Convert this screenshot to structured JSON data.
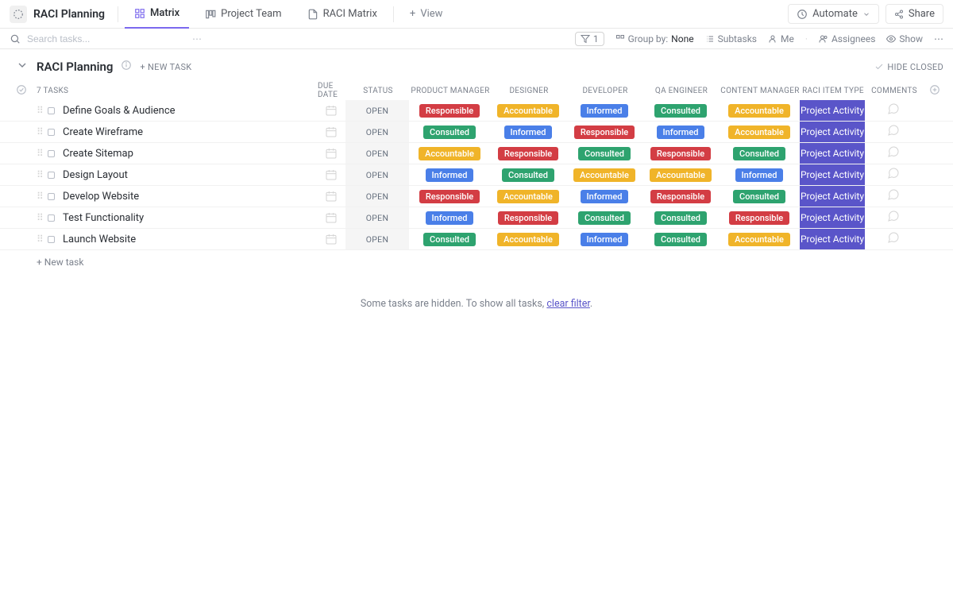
{
  "header": {
    "title": "RACI Planning",
    "tabs": [
      {
        "label": "Matrix",
        "active": true
      },
      {
        "label": "Project Team",
        "active": false
      },
      {
        "label": "RACI Matrix",
        "active": false
      }
    ],
    "view_btn": "View",
    "automate": "Automate",
    "share": "Share"
  },
  "toolbar": {
    "search_placeholder": "Search tasks...",
    "filter_count": "1",
    "group_by_label": "Group by:",
    "group_by_value": "None",
    "subtasks": "Subtasks",
    "me": "Me",
    "assignees": "Assignees",
    "show": "Show"
  },
  "list": {
    "name": "RACI Planning",
    "new_task": "+ NEW TASK",
    "hide_closed": "HIDE CLOSED",
    "task_count": "7 TASKS",
    "columns": {
      "due": "DUE DATE",
      "status": "STATUS",
      "pm": "PRODUCT MANAGER",
      "designer": "DESIGNER",
      "developer": "DEVELOPER",
      "qa": "QA ENGINEER",
      "cm": "CONTENT MANAGER",
      "type": "RACI ITEM TYPE",
      "comments": "COMMENTS"
    }
  },
  "tasks": [
    {
      "name": "Define Goals & Audience",
      "status": "OPEN",
      "pm": "Responsible",
      "designer": "Accountable",
      "developer": "Informed",
      "qa": "Consulted",
      "cm": "Accountable",
      "type": "Project Activity"
    },
    {
      "name": "Create Wireframe",
      "status": "OPEN",
      "pm": "Consulted",
      "designer": "Informed",
      "developer": "Responsible",
      "qa": "Informed",
      "cm": "Accountable",
      "type": "Project Activity"
    },
    {
      "name": "Create Sitemap",
      "status": "OPEN",
      "pm": "Accountable",
      "designer": "Responsible",
      "developer": "Consulted",
      "qa": "Responsible",
      "cm": "Consulted",
      "type": "Project Activity"
    },
    {
      "name": "Design Layout",
      "status": "OPEN",
      "pm": "Informed",
      "designer": "Consulted",
      "developer": "Accountable",
      "qa": "Accountable",
      "cm": "Informed",
      "type": "Project Activity"
    },
    {
      "name": "Develop Website",
      "status": "OPEN",
      "pm": "Responsible",
      "designer": "Accountable",
      "developer": "Informed",
      "qa": "Responsible",
      "cm": "Consulted",
      "type": "Project Activity"
    },
    {
      "name": "Test Functionality",
      "status": "OPEN",
      "pm": "Informed",
      "designer": "Responsible",
      "developer": "Consulted",
      "qa": "Consulted",
      "cm": "Responsible",
      "type": "Project Activity"
    },
    {
      "name": "Launch Website",
      "status": "OPEN",
      "pm": "Consulted",
      "designer": "Accountable",
      "developer": "Informed",
      "qa": "Consulted",
      "cm": "Accountable",
      "type": "Project Activity"
    }
  ],
  "footer": {
    "new_task": "+ New task",
    "hidden_msg": "Some tasks are hidden. To show all tasks, ",
    "clear_filter": "clear filter",
    "period": "."
  }
}
